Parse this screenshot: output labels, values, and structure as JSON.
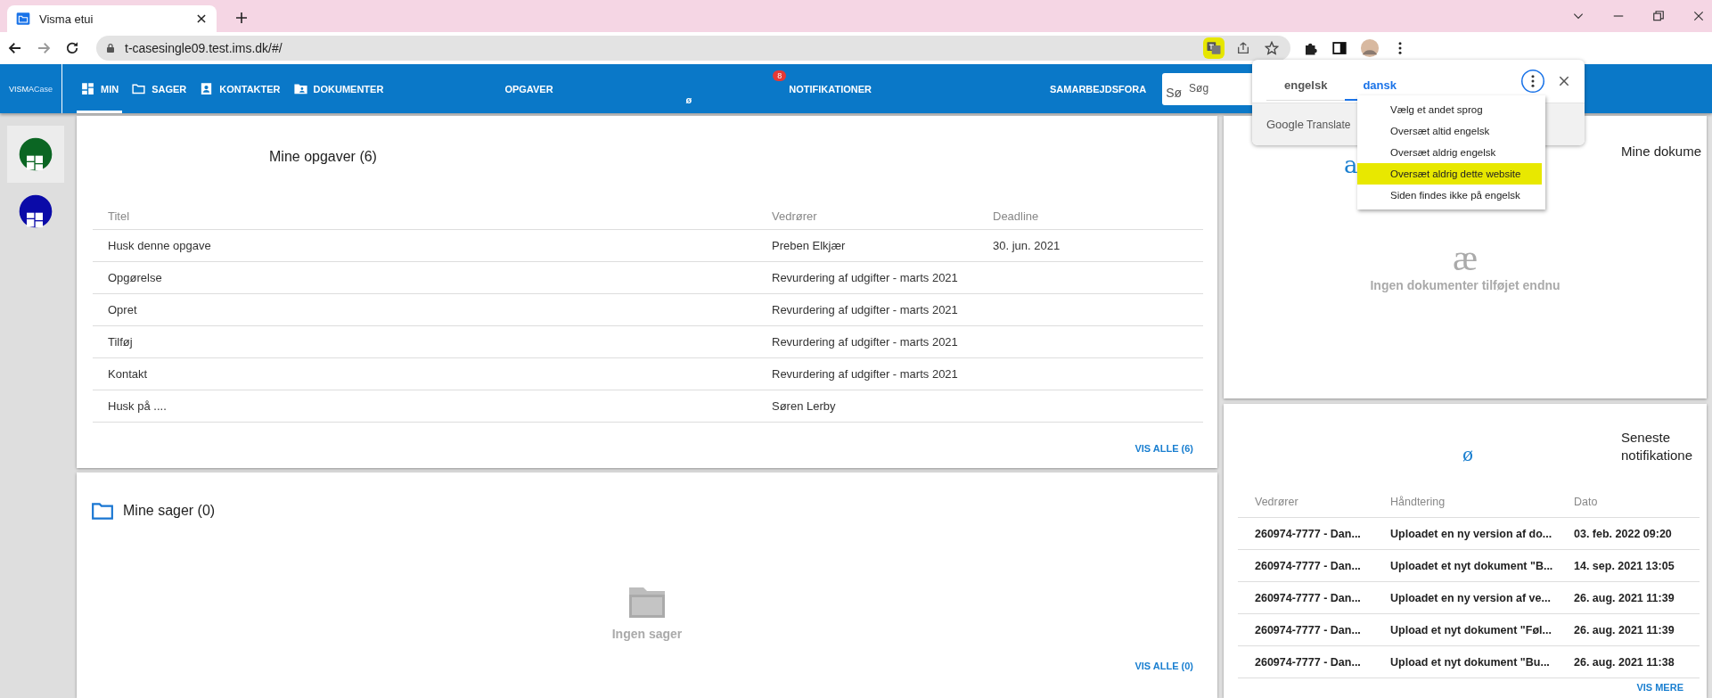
{
  "browser": {
    "tab": {
      "title": "Visma etui"
    },
    "address": "t-casesingle09.test.ims.dk/#/",
    "translate_highlighted": true
  },
  "app": {
    "logo": {
      "brand": "VISMA",
      "product": "Case"
    },
    "nav": [
      {
        "kind": "tab",
        "label": "MIN",
        "selected": true
      },
      {
        "kind": "tab",
        "label": "SAGER",
        "selected": false
      },
      {
        "kind": "tab",
        "label": "KONTAKTER",
        "selected": false
      },
      {
        "kind": "tab",
        "label": "DOKUMENTER",
        "selected": false
      },
      {
        "kind": "tab",
        "label": "OPGAVER",
        "selected": false
      },
      {
        "kind": "glyph",
        "label": "ø"
      },
      {
        "kind": "tab",
        "label": "NOTIFIKATIONER",
        "badge": "8",
        "selected": false
      },
      {
        "kind": "tab",
        "label": "SAMARBEJDSFORA",
        "selected": false
      }
    ],
    "search": {
      "prefix": "Sø",
      "placeholder": "Søg"
    },
    "sidebar": [
      {
        "color": "#0b6623",
        "selected": true
      },
      {
        "color": "#0a0aa8",
        "selected": false
      }
    ]
  },
  "tasks": {
    "title": "Mine opgaver (6)",
    "columns": [
      "Titel",
      "Vedrører",
      "Deadline"
    ],
    "rows": [
      [
        "Husk denne opgave",
        "Preben Elkjær",
        "30. jun. 2021"
      ],
      [
        "Opgørelse",
        "Revurdering af udgifter - marts 2021",
        ""
      ],
      [
        "Opret",
        "Revurdering af udgifter - marts 2021",
        ""
      ],
      [
        "Tilføj",
        "Revurdering af udgifter - marts 2021",
        ""
      ],
      [
        "Kontakt",
        "Revurdering af udgifter - marts 2021",
        ""
      ],
      [
        "Husk på ....",
        "Søren Lerby",
        ""
      ]
    ],
    "link": "VIS ALLE (6)"
  },
  "cases": {
    "title": "Mine sager (0)",
    "empty": "Ingen sager",
    "link": "VIS ALLE (0)"
  },
  "documents": {
    "title": "Mine dokume",
    "glyph": "a",
    "empty_glyph": "æ",
    "empty": "Ingen dokumenter tilføjet endnu"
  },
  "notifications": {
    "title": "Seneste notifikatione",
    "glyph": "ø",
    "columns": [
      "Vedrører",
      "Håndtering",
      "Dato"
    ],
    "rows": [
      [
        "260974-7777 - Dan...",
        "Uploadet en ny version af do...",
        "03. feb. 2022 09:20"
      ],
      [
        "260974-7777 - Dan...",
        "Uploadet et nyt dokument \"B...",
        "14. sep. 2021 13:05"
      ],
      [
        "260974-7777 - Dan...",
        "Uploadet en ny version af ve...",
        "26. aug. 2021 11:39"
      ],
      [
        "260974-7777 - Dan...",
        "Upload et nyt dokument \"Føl...",
        "26. aug. 2021 11:39"
      ],
      [
        "260974-7777 - Dan...",
        "Upload et nyt dokument \"Bu...",
        "26. aug. 2021 11:38"
      ]
    ],
    "link": "VIS MERE"
  },
  "translate_popup": {
    "tabs": [
      {
        "label": "engelsk",
        "selected": false
      },
      {
        "label": "dansk",
        "selected": true
      }
    ],
    "footer_brand": "Google",
    "footer_product": "Translate",
    "menu": [
      {
        "label": "Vælg et andet sprog",
        "highlighted": false
      },
      {
        "label": "Oversæt altid engelsk",
        "highlighted": false
      },
      {
        "label": "Oversæt aldrig engelsk",
        "highlighted": false
      },
      {
        "label": "Oversæt aldrig dette website",
        "highlighted": true
      },
      {
        "label": "Siden findes ikke på engelsk",
        "highlighted": false
      }
    ]
  }
}
